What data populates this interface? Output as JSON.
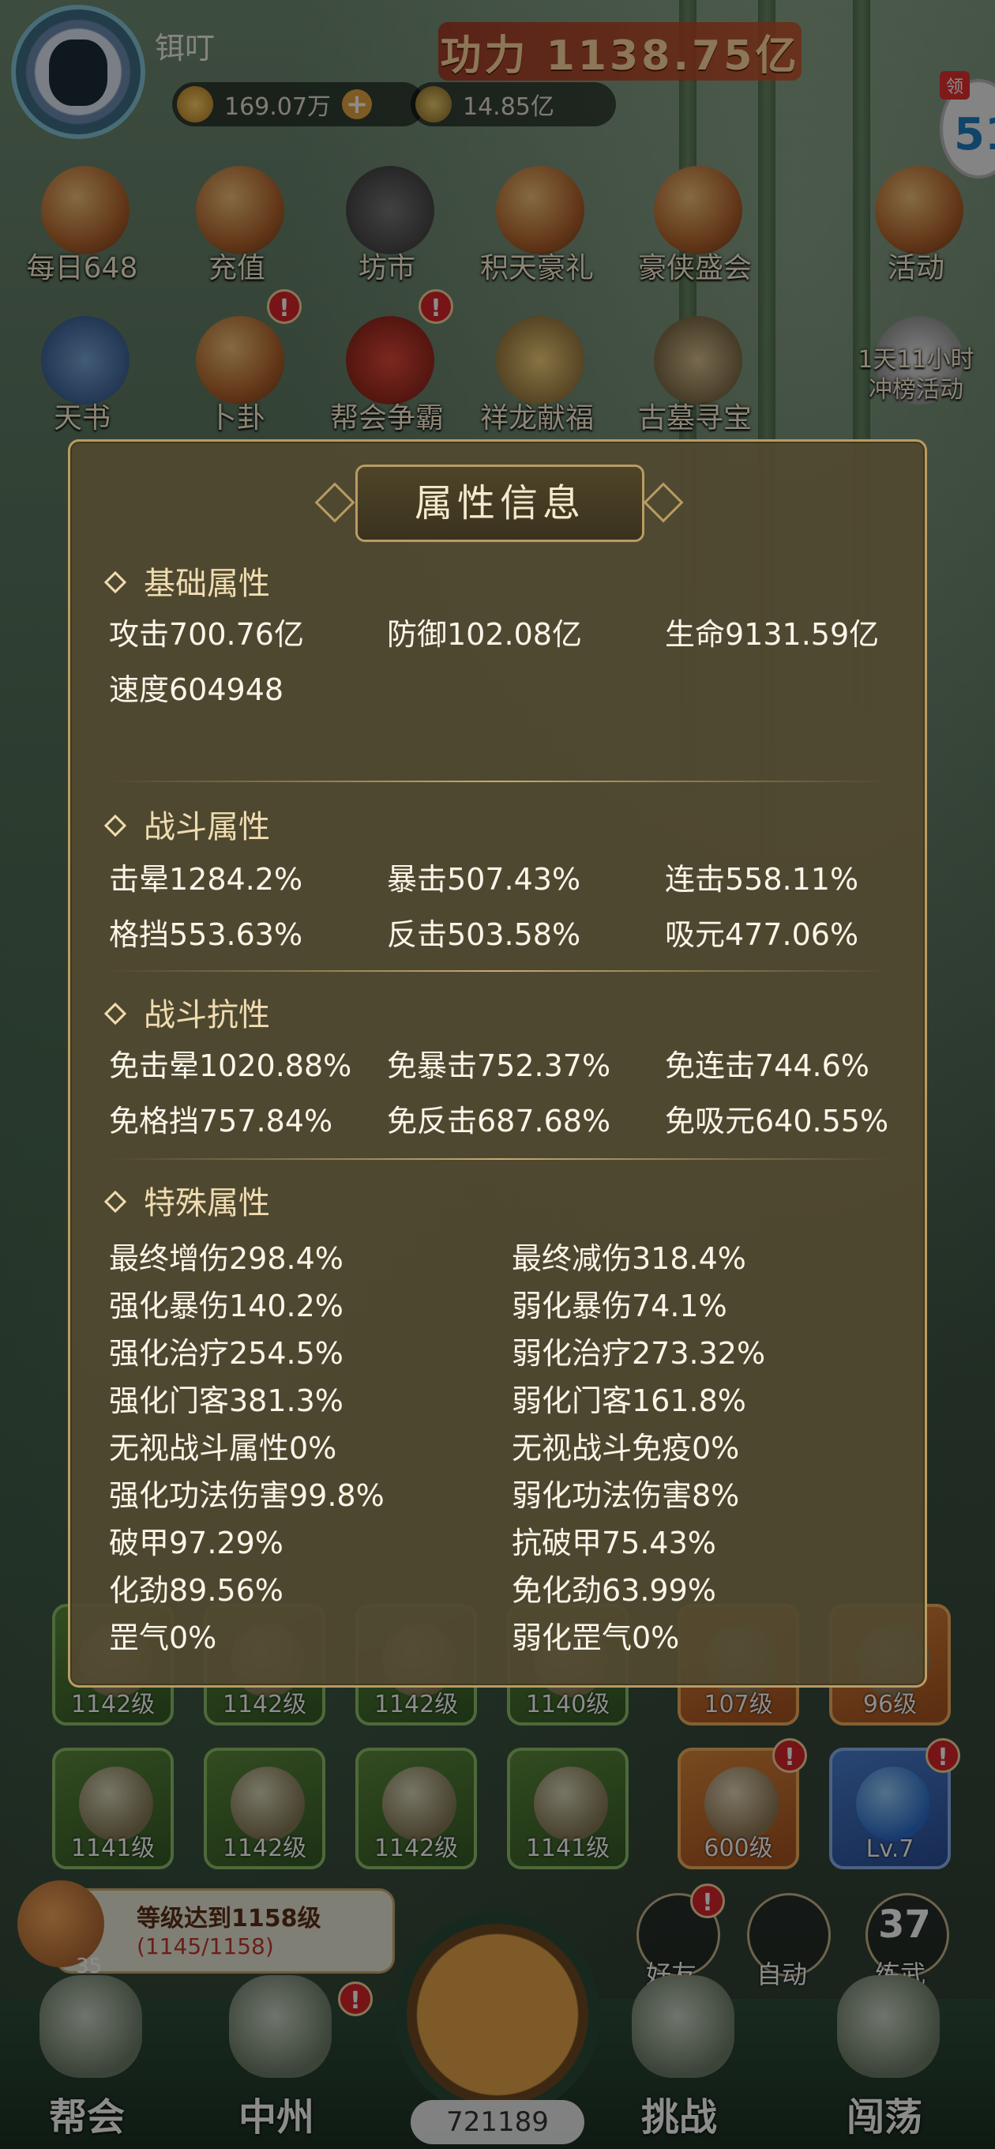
{
  "player": {
    "name": "铒叮",
    "power": "功力 1138.75亿"
  },
  "currency": {
    "gold": "169.07万",
    "coins": "14.85亿"
  },
  "claim": {
    "tag": "领",
    "value": "51"
  },
  "activities": [
    {
      "label": "每日648"
    },
    {
      "label": "充值"
    },
    {
      "label": "坊市"
    },
    {
      "label": "积天豪礼"
    },
    {
      "label": "豪侠盛会"
    },
    {
      "label": "活动"
    },
    {
      "label": "天书"
    },
    {
      "label": "卜卦"
    },
    {
      "label": "帮会争霸"
    },
    {
      "label": "祥龙献福"
    },
    {
      "label": "古墓寻宝"
    },
    {
      "label": "1天11小时"
    },
    {
      "label": "冲榜活动"
    }
  ],
  "panel": {
    "title": "属性信息",
    "basic": {
      "heading": "基础属性",
      "attack": "攻击700.76亿",
      "defense": "防御102.08亿",
      "hp": "生命9131.59亿",
      "speed": "速度604948"
    },
    "combat": {
      "heading": "战斗属性",
      "stun": "击晕1284.2%",
      "crit": "暴击507.43%",
      "combo": "连击558.11%",
      "block": "格挡553.63%",
      "counter": "反击503.58%",
      "absorb": "吸元477.06%"
    },
    "resist": {
      "heading": "战斗抗性",
      "stun": "免击晕1020.88%",
      "crit": "免暴击752.37%",
      "combo": "免连击744.6%",
      "block": "免格挡757.84%",
      "counter": "免反击687.68%",
      "absorb": "免吸元640.55%"
    },
    "special": {
      "heading": "特殊属性",
      "left": [
        "最终增伤298.4%",
        "强化暴伤140.2%",
        "强化治疗254.5%",
        "强化门客381.3%",
        "无视战斗属性0%",
        "强化功法伤害99.8%",
        "破甲97.29%",
        "化劲89.56%",
        "罡气0%"
      ],
      "right": [
        "最终减伤318.4%",
        "弱化暴伤74.1%",
        "弱化治疗273.32%",
        "弱化门客161.8%",
        "无视战斗免疫0%",
        "弱化功法伤害8%",
        "抗破甲75.43%",
        "免化劲63.99%",
        "弱化罡气0%"
      ]
    }
  },
  "slots_row1": [
    "1142级",
    "1142级",
    "1142级",
    "1140级",
    "107级",
    "96级"
  ],
  "slots_row2": [
    "1141级",
    "1142级",
    "1142级",
    "1141级",
    "600级",
    "Lv.7"
  ],
  "quest": {
    "line1": "等级达到1158级",
    "line2": "(1145/1158)",
    "drum_count": "35"
  },
  "round_buttons": {
    "friends": "好友",
    "auto": "自动",
    "practice": "练武",
    "practice_count": "37"
  },
  "nav": {
    "guild": "帮会",
    "zhongzhou": "中州",
    "challenge": "挑战",
    "roam": "闯荡",
    "food": "721189"
  },
  "badge": "!",
  "colors": {
    "panel_bg": "#524930",
    "panel_border": "#b89c62",
    "badge_red": "#d8262a"
  }
}
